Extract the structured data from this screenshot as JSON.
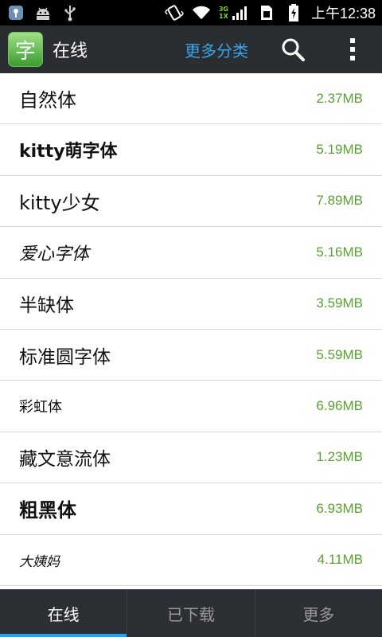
{
  "status_bar": {
    "time": "上午12:38",
    "network": {
      "top": "3G",
      "bottom": "1X"
    },
    "icons": [
      "app-notification-icon",
      "android-icon",
      "usb-icon",
      "vibrate-icon",
      "wifi-icon",
      "signal-icon",
      "sim-icon",
      "battery-charging-icon"
    ]
  },
  "action_bar": {
    "logo_glyph": "字",
    "title": "在线",
    "more_categories": "更多分类",
    "icons": [
      "search-icon",
      "overflow-menu-icon"
    ]
  },
  "fonts": [
    {
      "name": "自然体",
      "size": "2.37MB"
    },
    {
      "name": "kitty萌字体",
      "size": "5.19MB"
    },
    {
      "name": "kitty少女",
      "size": "7.89MB"
    },
    {
      "name": "爱心字体",
      "size": "5.16MB"
    },
    {
      "name": "半缺体",
      "size": "3.59MB"
    },
    {
      "name": "标准圆字体",
      "size": "5.59MB"
    },
    {
      "name": "彩虹体",
      "size": "6.96MB"
    },
    {
      "name": "藏文意流体",
      "size": "1.23MB"
    },
    {
      "name": "粗黑体",
      "size": "6.93MB"
    },
    {
      "name": "大姨妈",
      "size": "4.11MB"
    }
  ],
  "tabs": [
    {
      "label": "在线",
      "active": true
    },
    {
      "label": "已下载",
      "active": false
    },
    {
      "label": "更多",
      "active": false
    }
  ],
  "colors": {
    "accent_blue": "#39a3e8",
    "size_green": "#58a22f",
    "bar_dark": "#2b2e31"
  }
}
